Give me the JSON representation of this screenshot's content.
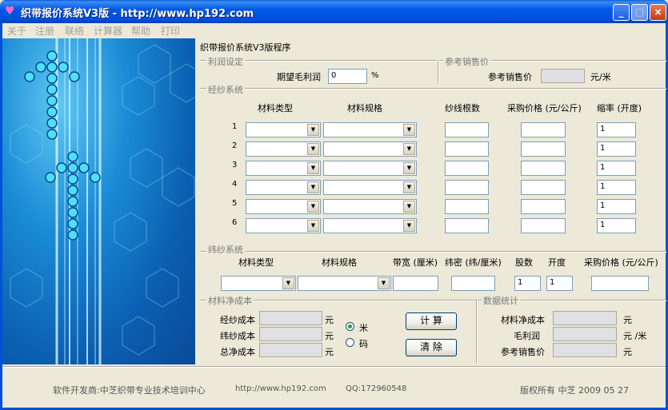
{
  "window": {
    "title": "织带报价系统V3版 - http://www.hp192.com",
    "icon": "heart-icon",
    "controls": {
      "minimize": "_",
      "maximize": "□",
      "close": "×"
    }
  },
  "menu": [
    "关于",
    "注册",
    "联络",
    "计算器",
    "帮助",
    "打印"
  ],
  "program_title": "织带报价系统V3版程序",
  "profit": {
    "section": "利润设定",
    "label": "期望毛利润",
    "value": "0",
    "unit": "%"
  },
  "ref_price": {
    "section": "参考销售价",
    "label": "参考销售价",
    "unit": "元/米"
  },
  "warp": {
    "section": "经纱系统",
    "headers": [
      "材料类型",
      "材料规格",
      "纱线根数",
      "采购价格 (元/公斤)",
      "缩率 (开度)"
    ],
    "rows": [
      {
        "num": "1",
        "shrink": "1"
      },
      {
        "num": "2",
        "shrink": "1"
      },
      {
        "num": "3",
        "shrink": "1"
      },
      {
        "num": "4",
        "shrink": "1"
      },
      {
        "num": "5",
        "shrink": "1"
      },
      {
        "num": "6",
        "shrink": "1"
      }
    ]
  },
  "weft": {
    "section": "纬纱系统",
    "headers": [
      "材料类型",
      "材料规格",
      "带宽 (厘米)",
      "纬密 (纬/厘米)",
      "股数",
      "开度",
      "采购价格 (元/公斤)"
    ],
    "strands": "1",
    "opening": "1"
  },
  "net_cost": {
    "section": "材料净成本",
    "rows": [
      {
        "label": "经纱成本",
        "unit": "元"
      },
      {
        "label": "纬纱成本",
        "unit": "元"
      },
      {
        "label": "总净成本",
        "unit": "元"
      }
    ],
    "radio_meter": "米",
    "radio_code": "码"
  },
  "buttons": {
    "calculate": "计 算",
    "clear": "清 除"
  },
  "stats": {
    "section": "数据统计",
    "rows": [
      {
        "label": "材料净成本",
        "unit": "元"
      },
      {
        "label": "毛利润",
        "unit": "元  /米"
      },
      {
        "label": "参考销售价",
        "unit": "元"
      }
    ]
  },
  "footer": {
    "developer": "软件开发商:中芝织带专业技术培训中心",
    "url": "http://www.hp192.com",
    "qq": "QQ:172960548",
    "copyright": "版权所有 中芝 2009 05 27"
  },
  "colors": {
    "titlebar": "#0058E6",
    "background": "#ECE9D8",
    "banner": "#1A8CD6"
  }
}
